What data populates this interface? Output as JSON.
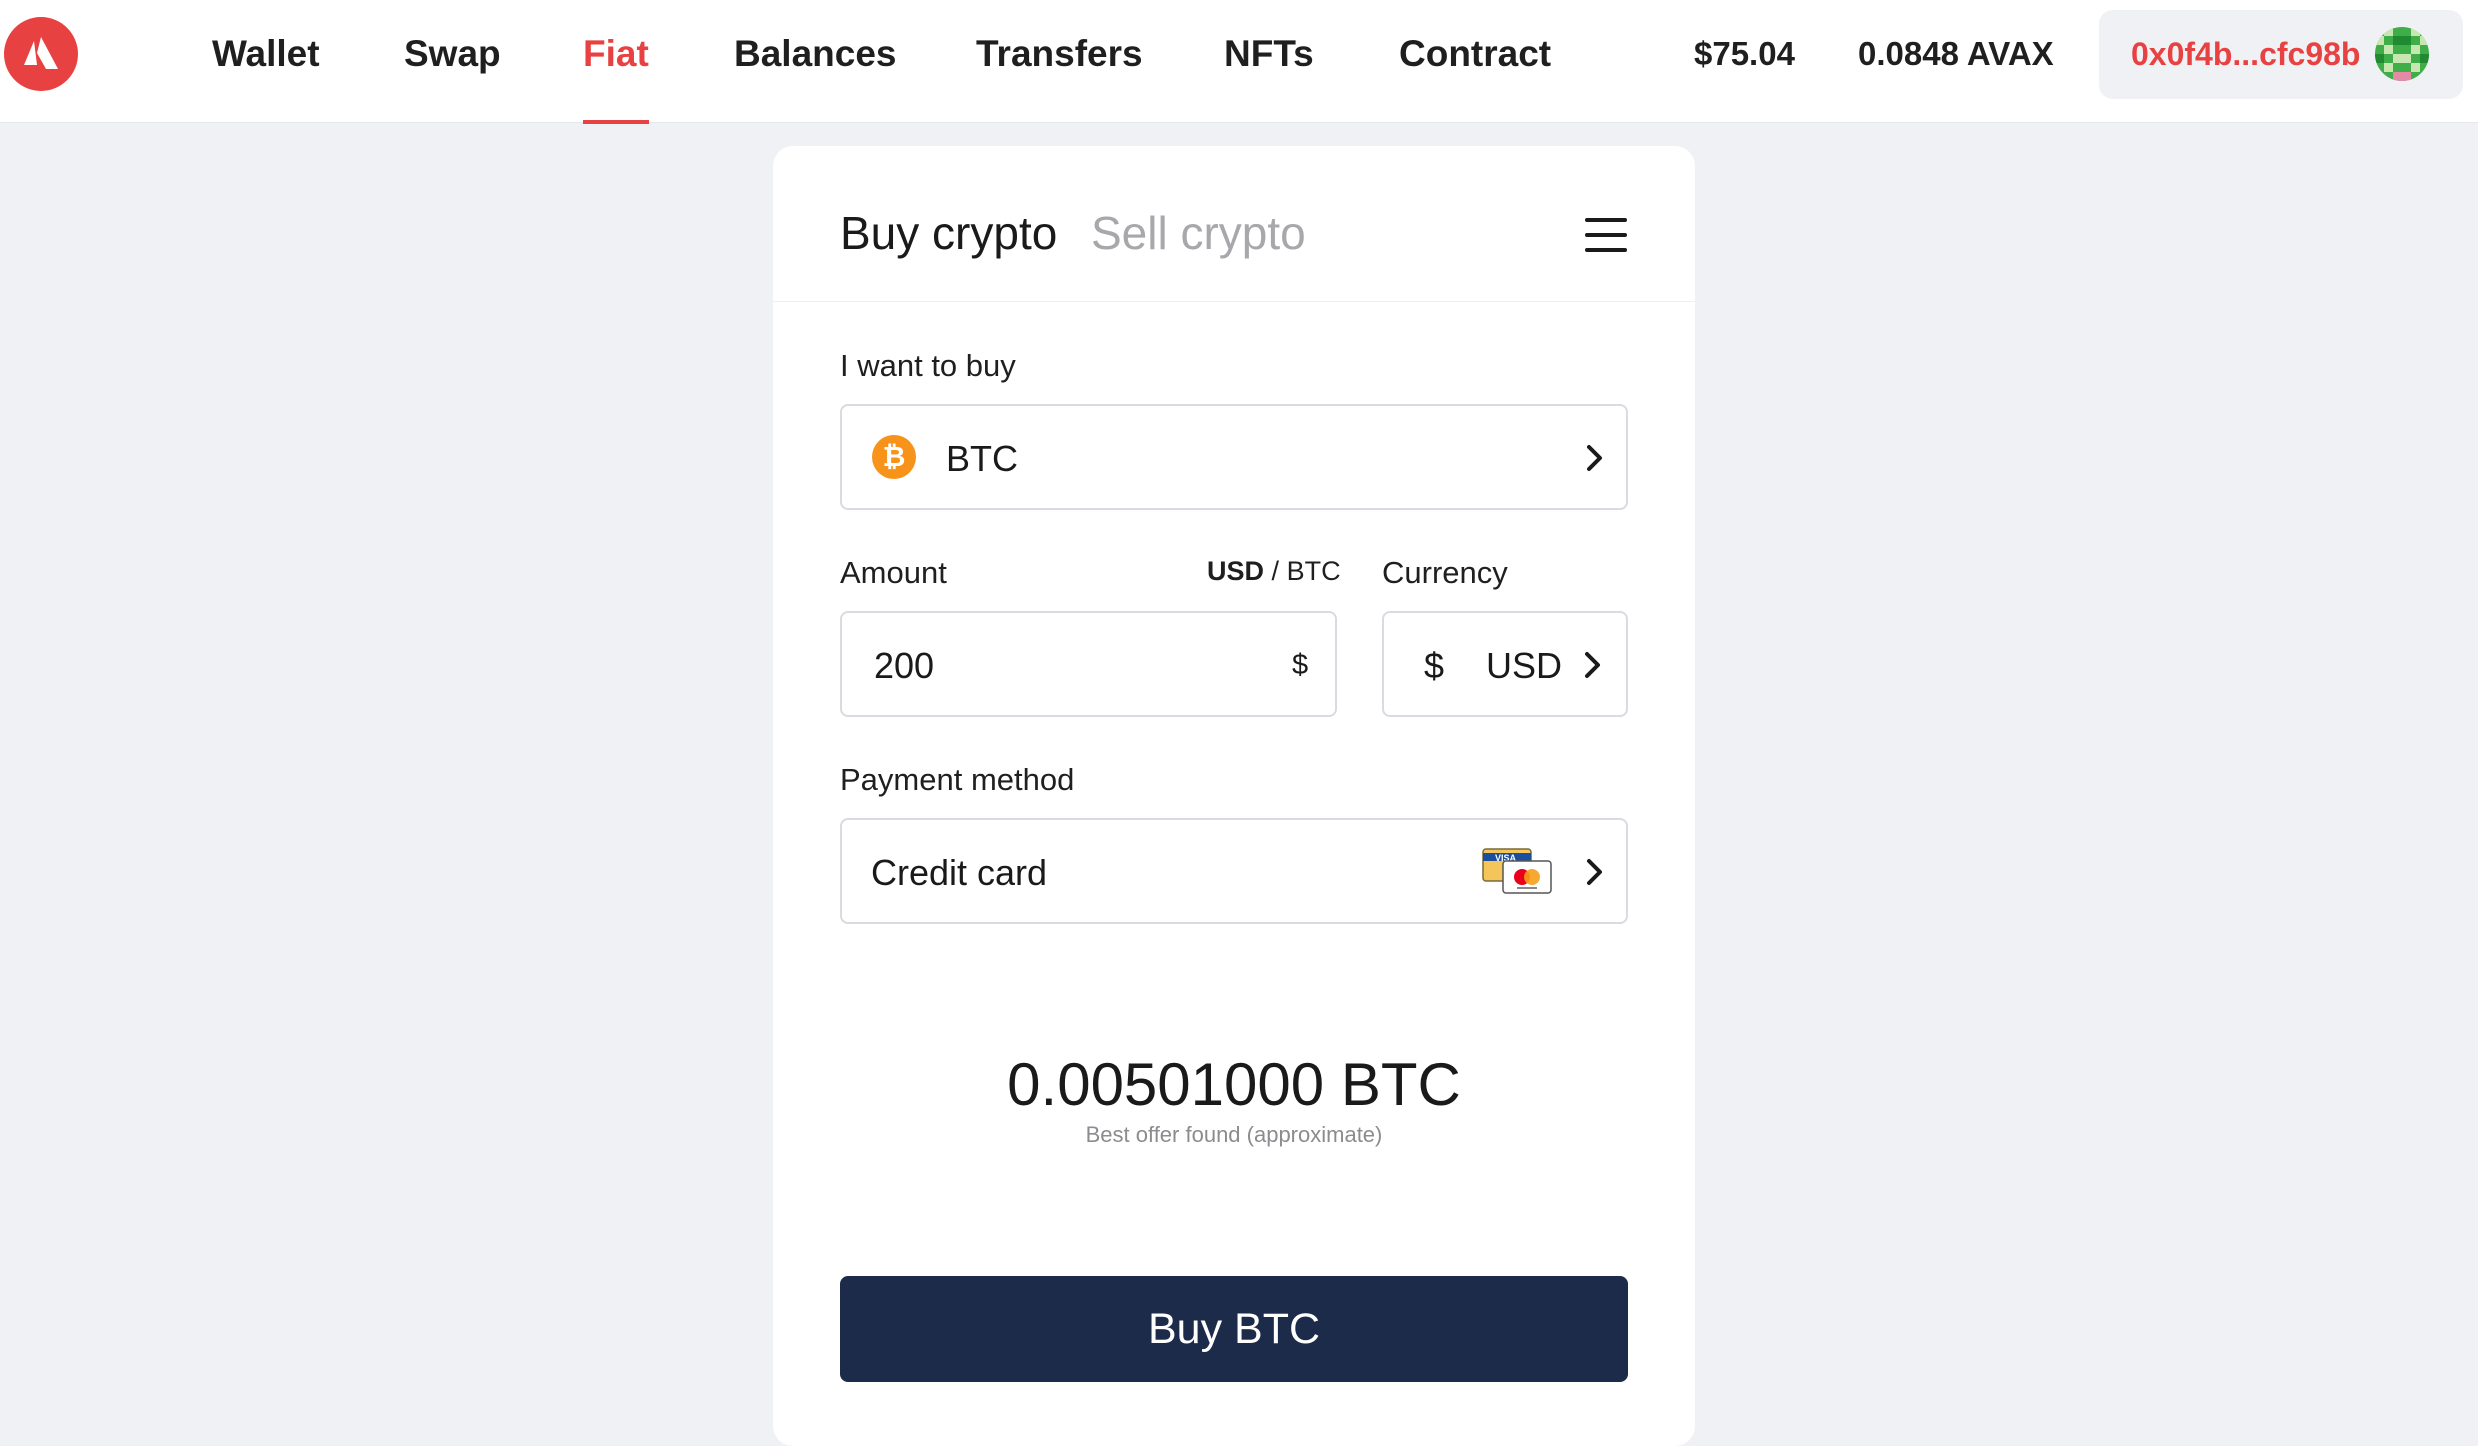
{
  "nav": {
    "items": [
      {
        "label": "Wallet",
        "active": false
      },
      {
        "label": "Swap",
        "active": false
      },
      {
        "label": "Fiat",
        "active": true
      },
      {
        "label": "Balances",
        "active": false
      },
      {
        "label": "Transfers",
        "active": false
      },
      {
        "label": "NFTs",
        "active": false
      },
      {
        "label": "Contract",
        "active": false
      }
    ],
    "usd_balance": "$75.04",
    "avax_balance": "0.0848 AVAX",
    "address": "0x0f4b...cfc98b"
  },
  "colors": {
    "accent": "#e84142",
    "button": "#1d2b4b",
    "page_bg": "#f0f1f5",
    "btc_orange": "#f7931a"
  },
  "card": {
    "tabs": {
      "buy": "Buy crypto",
      "sell": "Sell crypto"
    },
    "want_to_buy_label": "I want to buy",
    "asset": {
      "symbol": "BTC",
      "icon": "bitcoin-icon"
    },
    "amount_label": "Amount",
    "unit_toggle": {
      "selected": "USD",
      "separator": "/",
      "other": "BTC"
    },
    "amount_value": "200",
    "amount_symbol": "$",
    "currency_label": "Currency",
    "currency_symbol": "$",
    "currency_code": "USD",
    "payment_label": "Payment method",
    "payment_value": "Credit card",
    "payment_icon": "visa-mastercard-icon",
    "result_amount": "0.00501000 BTC",
    "result_note": "Best offer found (approximate)",
    "buy_button": "Buy BTC"
  }
}
